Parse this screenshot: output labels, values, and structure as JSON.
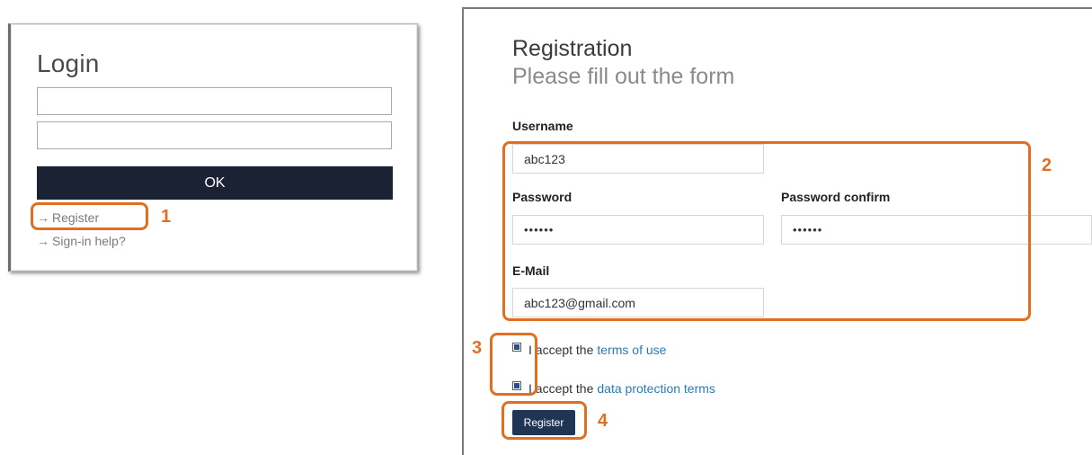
{
  "login": {
    "title": "Login",
    "username_value": "",
    "password_value": "",
    "ok_label": "OK",
    "arrow": "→",
    "register_link": "Register",
    "help_link": "Sign-in help?"
  },
  "registration": {
    "title": "Registration",
    "subtitle": "Please fill out the form",
    "username_label": "Username",
    "username_value": "abc123",
    "password_label": "Password",
    "password_value": "••••••",
    "password_confirm_label": "Password confirm",
    "password_confirm_value": "••••••",
    "email_label": "E-Mail",
    "email_value": "abc123@gmail.com",
    "accept_prefix": "I accept the",
    "terms_link": "terms of use",
    "data_protection_link": "data protection terms",
    "terms_checked": true,
    "data_protection_checked": true,
    "register_label": "Register"
  },
  "annotations": [
    "1",
    "2",
    "3",
    "4"
  ],
  "colors": {
    "accent_orange": "#e07020",
    "ok_button_bg": "#1a2233",
    "register_button_bg": "#1f3553",
    "link_blue": "#2a7ab8"
  },
  "icons": {
    "link_arrow": "arrow-right-icon",
    "checkbox": "checkbox-checked-icon"
  }
}
